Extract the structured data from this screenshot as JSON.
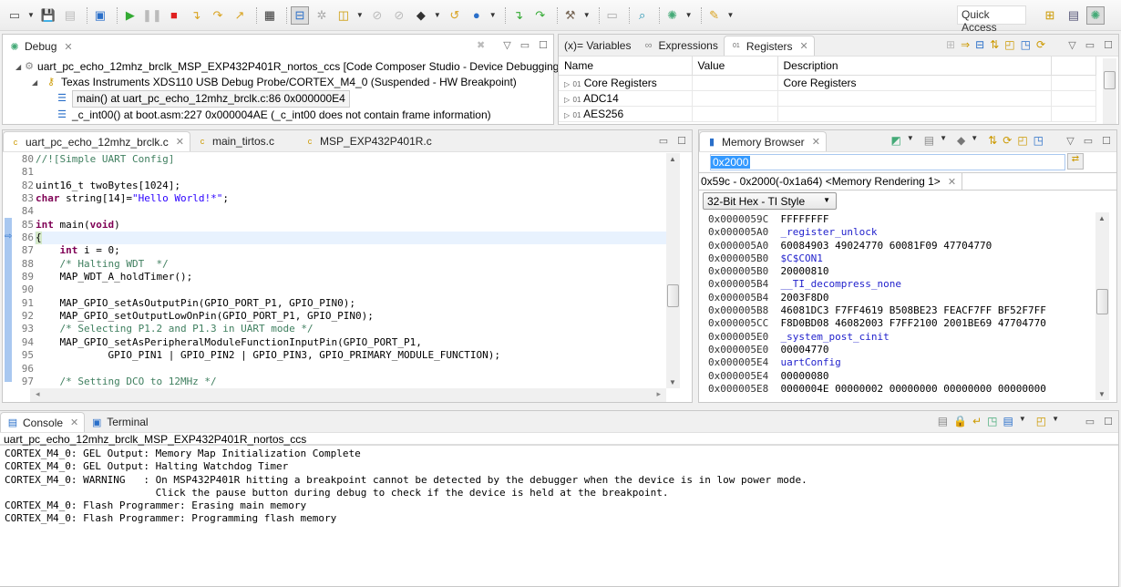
{
  "toolbar": {
    "icons": [
      "new-icon",
      "save-icon",
      "save-all-icon",
      "debug-view-icon",
      "resume-icon",
      "suspend-icon",
      "terminate-icon",
      "step-into-icon",
      "step-over-icon",
      "step-return-icon",
      "memory-map-icon",
      "connect-target-icon",
      "breakpoint-icon",
      "load-program-icon",
      "disable-breakpoint-icon",
      "skip-breakpoint-icon",
      "target-config-icon",
      "restart-icon",
      "reset-icon",
      "asm-step-into-icon",
      "asm-step-over-icon",
      "build-icon",
      "open-icon",
      "search-icon",
      "debug-icon",
      "flash-icon"
    ],
    "quick_access": "Quick Access"
  },
  "debug": {
    "tab": "Debug",
    "items": [
      {
        "label": "uart_pc_echo_12mhz_brclk_MSP_EXP432P401R_nortos_ccs [Code Composer Studio - Device Debugging]"
      },
      {
        "label": "Texas Instruments XDS110 USB Debug Probe/CORTEX_M4_0 (Suspended - HW Breakpoint)"
      },
      {
        "label": "main() at uart_pc_echo_12mhz_brclk.c:86 0x000000E4"
      },
      {
        "label": "_c_int00() at boot.asm:227 0x000004AE  (_c_int00 does not contain frame information)"
      }
    ]
  },
  "registers": {
    "tabs": [
      "(x)= Variables",
      "Expressions",
      "Registers"
    ],
    "columns": [
      "Name",
      "Value",
      "Description"
    ],
    "rows": [
      {
        "name": "Core Registers",
        "value": "",
        "desc": "Core Registers"
      },
      {
        "name": "ADC14",
        "value": "",
        "desc": ""
      },
      {
        "name": "AES256",
        "value": "",
        "desc": ""
      }
    ]
  },
  "editor": {
    "tabs": [
      "uart_pc_echo_12mhz_brclk.c",
      "main_tirtos.c",
      "MSP_EXP432P401R.c"
    ],
    "lines": [
      {
        "n": "80",
        "t": "//![Simple UART Config]"
      },
      {
        "n": "81",
        "t": ""
      },
      {
        "n": "82",
        "t": "uint16_t twoBytes[1024];"
      },
      {
        "n": "83",
        "t": "char string[14]=\"Hello World!*\";"
      },
      {
        "n": "84",
        "t": ""
      },
      {
        "n": "85",
        "t": "int main(void)"
      },
      {
        "n": "86",
        "t": "{"
      },
      {
        "n": "87",
        "t": "    int i = 0;"
      },
      {
        "n": "88",
        "t": "    /* Halting WDT  */"
      },
      {
        "n": "89",
        "t": "    MAP_WDT_A_holdTimer();"
      },
      {
        "n": "90",
        "t": ""
      },
      {
        "n": "91",
        "t": "    MAP_GPIO_setAsOutputPin(GPIO_PORT_P1, GPIO_PIN0);"
      },
      {
        "n": "92",
        "t": "    MAP_GPIO_setOutputLowOnPin(GPIO_PORT_P1, GPIO_PIN0);"
      },
      {
        "n": "93",
        "t": "    /* Selecting P1.2 and P1.3 in UART mode */"
      },
      {
        "n": "94",
        "t": "    MAP_GPIO_setAsPeripheralModuleFunctionInputPin(GPIO_PORT_P1,"
      },
      {
        "n": "95",
        "t": "            GPIO_PIN1 | GPIO_PIN2 | GPIO_PIN3, GPIO_PRIMARY_MODULE_FUNCTION);"
      },
      {
        "n": "96",
        "t": ""
      },
      {
        "n": "97",
        "t": "    /* Setting DCO to 12MHz */"
      }
    ]
  },
  "memory": {
    "tab": "Memory Browser",
    "address": "0x2000",
    "rendering_tab": "0x59c - 0x2000(-0x1a64) <Memory Rendering 1>",
    "format": "32-Bit Hex - TI Style",
    "rows": [
      {
        "addr": "0x0000059C",
        "val": "FFFFFFFF",
        "label": false
      },
      {
        "addr": "0x000005A0",
        "val": "_register_unlock",
        "label": true
      },
      {
        "addr": "0x000005A0",
        "val": "60084903 49024770 60081F09 47704770",
        "label": false
      },
      {
        "addr": "0x000005B0",
        "val": "$C$CON1",
        "label": true
      },
      {
        "addr": "0x000005B0",
        "val": "20000810",
        "label": false
      },
      {
        "addr": "0x000005B4",
        "val": "__TI_decompress_none",
        "label": true
      },
      {
        "addr": "0x000005B4",
        "val": "2003F8D0",
        "label": false
      },
      {
        "addr": "0x000005B8",
        "val": "46081DC3 F7FF4619 B508BE23 FEACF7FF BF52F7FF",
        "label": false
      },
      {
        "addr": "0x000005CC",
        "val": "F8D0BD08 46082003 F7FF2100 2001BE69 47704770",
        "label": false
      },
      {
        "addr": "0x000005E0",
        "val": "_system_post_cinit",
        "label": true
      },
      {
        "addr": "0x000005E0",
        "val": "00004770",
        "label": false
      },
      {
        "addr": "0x000005E4",
        "val": "uartConfig",
        "label": true
      },
      {
        "addr": "0x000005E4",
        "val": "00000080",
        "label": false
      },
      {
        "addr": "0x000005E8",
        "val": "0000004E 00000002 00000000 00000000 00000000",
        "label": false
      }
    ]
  },
  "console": {
    "tabs": [
      "Console",
      "Terminal"
    ],
    "title": "uart_pc_echo_12mhz_brclk_MSP_EXP432P401R_nortos_ccs",
    "lines": [
      "CORTEX_M4_0: GEL Output: Memory Map Initialization Complete",
      "CORTEX_M4_0: GEL Output: Halting Watchdog Timer",
      "CORTEX_M4_0: WARNING   : On MSP432P401R hitting a breakpoint cannot be detected by the debugger when the device is in low power mode.",
      "                         Click the pause button during debug to check if the device is held at the breakpoint.",
      "CORTEX_M4_0: Flash Programmer: Erasing main memory",
      "CORTEX_M4_0: Flash Programmer: Programming flash memory"
    ]
  },
  "colors": {
    "keyword": "#7f0055",
    "comment": "#3f7f5f",
    "string": "#2a00ff",
    "label": "#2222cc",
    "current_line": "#e8f2fe",
    "selection": "#3399ff"
  }
}
